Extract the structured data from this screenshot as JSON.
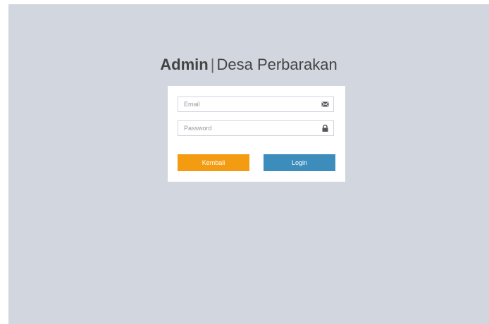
{
  "header": {
    "app_name": "Admin",
    "separator": "|",
    "subtitle": "Desa Perbarakan"
  },
  "form": {
    "email": {
      "value": "",
      "placeholder": "Email",
      "icon": "envelope-icon"
    },
    "password": {
      "value": "",
      "placeholder": "Password",
      "icon": "lock-icon"
    },
    "back_label": "Kembali",
    "login_label": "Login"
  },
  "colors": {
    "background": "#d2d6de",
    "back_button": "#f39c12",
    "login_button": "#3c8dbc"
  }
}
